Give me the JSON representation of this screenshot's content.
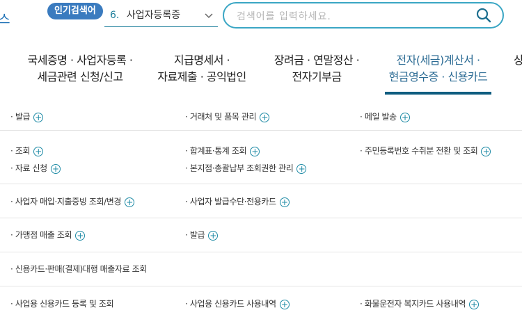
{
  "top": {
    "left_mark": "스",
    "popular_badge": "인기검색어",
    "popular_rank": "6.",
    "popular_term": "사업자등록증",
    "search_placeholder": "검색어를 입력하세요."
  },
  "nav": {
    "items": [
      {
        "line1": "국세증명 · 사업자등록 ·",
        "line2": "세금관련 신청/신고",
        "active": false
      },
      {
        "line1": "지급명세서 ·",
        "line2": "자료제출 · 공익법인",
        "active": false
      },
      {
        "line1": "장려금 · 연말정산 ·",
        "line2": "전자기부금",
        "active": false
      },
      {
        "line1": "전자(세금)계산서 ·",
        "line2": "현금영수증 · 신용카드",
        "active": true
      },
      {
        "line1": "상",
        "line2": "",
        "active": false
      }
    ]
  },
  "menu": {
    "rows": [
      {
        "cells": [
          {
            "label": "· 발급",
            "plus": true
          },
          {
            "label": "· 거래처 및 품목 관리",
            "plus": true
          },
          {
            "label": "· 메일 발송",
            "plus": true
          }
        ]
      },
      {
        "cells": [
          {
            "label": "· 조회",
            "plus": true
          },
          {
            "label": "· 합계표·통계 조회",
            "plus": true
          },
          {
            "label": "· 주민등록번호 수취분 전환 및 조회",
            "plus": true
          }
        ],
        "cells2": [
          {
            "label": "· 자료 신청",
            "plus": true
          },
          {
            "label": "· 본지점·총괄납부 조회권한 관리",
            "plus": true
          }
        ]
      },
      {
        "cells": [
          {
            "label": "· 사업자 매입·지출증빙 조회/변경",
            "plus": true
          },
          {
            "label": "· 사업자 발급수단·전용카드",
            "plus": true
          }
        ]
      },
      {
        "cells": [
          {
            "label": "· 가맹점 매출 조회",
            "plus": true
          },
          {
            "label": "· 발급",
            "plus": true
          }
        ]
      },
      {
        "cells": [
          {
            "label": "· 신용카드·판매(결제)대행 매출자료 조회",
            "plus": false
          }
        ]
      },
      {
        "cells": [
          {
            "label": "· 사업용 신용카드 등록 및 조회",
            "plus": false
          },
          {
            "label": "· 사업용 신용카드 사용내역",
            "plus": true
          },
          {
            "label": "· 화물운전자 복지카드 사용내역",
            "plus": true
          }
        ]
      }
    ]
  }
}
